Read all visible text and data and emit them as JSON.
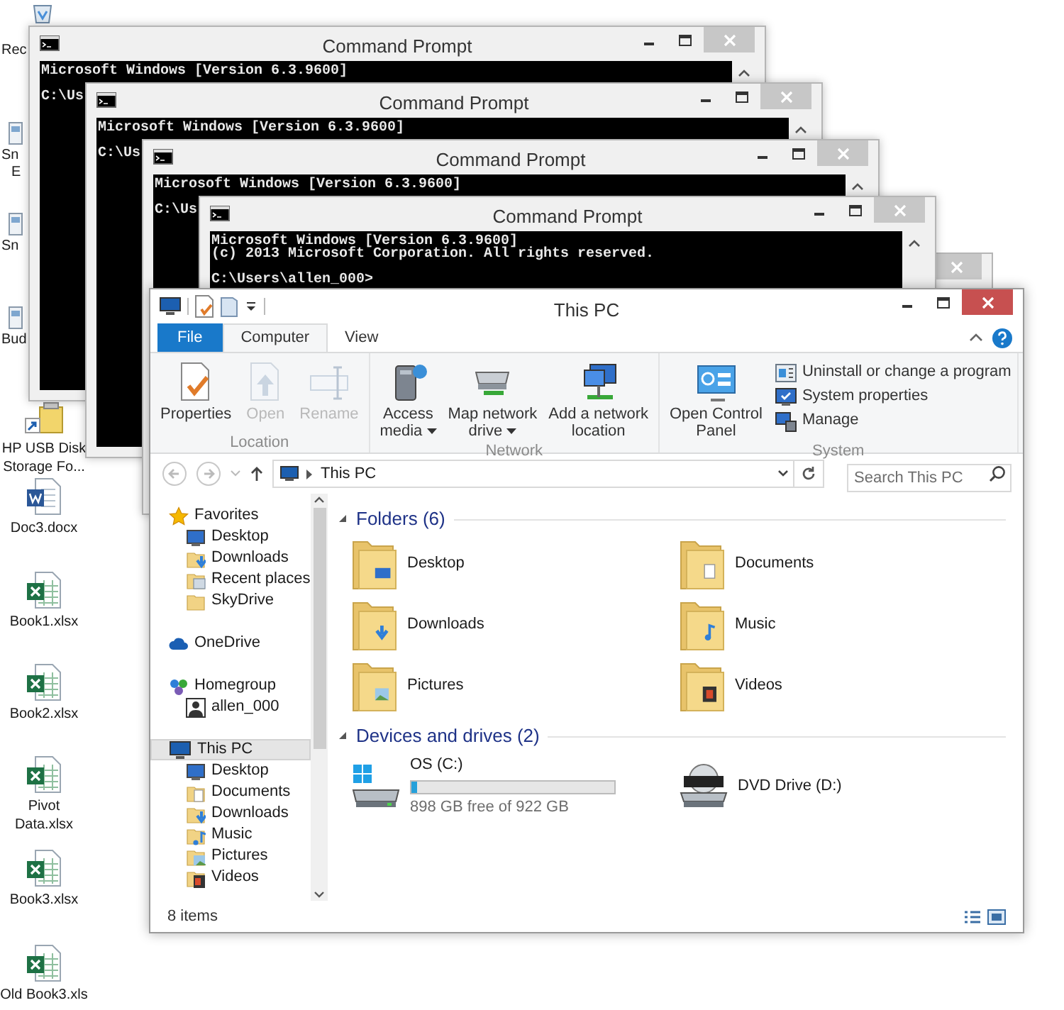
{
  "desktop_icons": [
    {
      "kind": "recycle",
      "lines": [
        "Rec"
      ]
    },
    {
      "kind": "app",
      "lines": [
        "Sn",
        "E"
      ]
    },
    {
      "kind": "app",
      "lines": [
        "Sn"
      ]
    },
    {
      "kind": "app",
      "lines": [
        "Bud"
      ]
    },
    {
      "kind": "usb",
      "lines": [
        "HP USB Disk",
        "Storage Fo..."
      ]
    },
    {
      "kind": "word",
      "lines": [
        "Doc3.docx"
      ]
    },
    {
      "kind": "excel",
      "lines": [
        "Book1.xlsx"
      ]
    },
    {
      "kind": "excel",
      "lines": [
        "Book2.xlsx"
      ]
    },
    {
      "kind": "excel",
      "lines": [
        "Pivot",
        "Data.xlsx"
      ]
    },
    {
      "kind": "excel",
      "lines": [
        "Book3.xlsx"
      ]
    },
    {
      "kind": "excel",
      "lines": [
        "Old Book3.xls"
      ]
    }
  ],
  "console_windows": [
    {
      "title": "Command Prompt",
      "output": [
        "Microsoft Windows [Version 6.3.9600]"
      ],
      "prompt": "C:\\Us"
    },
    {
      "title": "Command Prompt",
      "output": [
        "Microsoft Windows [Version 6.3.9600]"
      ],
      "prompt": "C:\\Us"
    },
    {
      "title": "Command Prompt",
      "output": [
        "Microsoft Windows [Version 6.3.9600]"
      ],
      "prompt": "C:\\Us"
    },
    {
      "title": "Command Prompt",
      "output": [
        "Microsoft Windows [Version 6.3.9600]",
        "(c) 2013 Microsoft Corporation. All rights reserved."
      ],
      "prompt": "C:\\Users\\allen_000>"
    }
  ],
  "background_window": {
    "visible": true
  },
  "explorer": {
    "title": "This PC",
    "tabs": [
      {
        "label": "File",
        "kind": "file",
        "selected": false
      },
      {
        "label": "Computer",
        "kind": "tab",
        "selected": true
      },
      {
        "label": "View",
        "kind": "tab",
        "selected": false
      }
    ],
    "ribbon_groups": [
      {
        "label": "Location",
        "buttons": [
          {
            "lines": [
              "Properties"
            ],
            "kind": "properties",
            "disabled": false,
            "dropdown": false
          },
          {
            "lines": [
              "Open"
            ],
            "kind": "open",
            "disabled": true,
            "dropdown": false
          },
          {
            "lines": [
              "Rename"
            ],
            "kind": "rename",
            "disabled": true,
            "dropdown": false
          }
        ]
      },
      {
        "label": "Network",
        "buttons": [
          {
            "lines": [
              "Access",
              "media"
            ],
            "kind": "media",
            "disabled": false,
            "dropdown": true
          },
          {
            "lines": [
              "Map network",
              "drive"
            ],
            "kind": "netdrive",
            "disabled": false,
            "dropdown": true
          },
          {
            "lines": [
              "Add a network",
              "location"
            ],
            "kind": "netloc",
            "disabled": false,
            "dropdown": false
          }
        ]
      },
      {
        "label": "System",
        "buttons": [
          {
            "lines": [
              "Open Control",
              "Panel"
            ],
            "kind": "control",
            "disabled": false,
            "dropdown": false
          }
        ],
        "small_buttons": [
          {
            "label": "Uninstall or change a program",
            "kind": "uninstall"
          },
          {
            "label": "System properties",
            "kind": "sysprops"
          },
          {
            "label": "Manage",
            "kind": "manage"
          }
        ]
      }
    ],
    "address": {
      "path": "This PC"
    },
    "search": {
      "placeholder": "Search This PC"
    },
    "nav": [
      {
        "label": "Favorites",
        "kind": "star",
        "selected": false,
        "children": [
          {
            "label": "Desktop",
            "kind": "desktop",
            "selected": false
          },
          {
            "label": "Downloads",
            "kind": "downloads",
            "selected": false
          },
          {
            "label": "Recent places",
            "kind": "recent",
            "selected": false
          },
          {
            "label": "SkyDrive",
            "kind": "folder",
            "selected": false
          }
        ]
      },
      {
        "label": "OneDrive",
        "kind": "cloud",
        "selected": false
      },
      {
        "label": "Homegroup",
        "kind": "homegroup",
        "selected": false,
        "children": [
          {
            "label": "allen_000",
            "kind": "user",
            "selected": false
          }
        ]
      },
      {
        "label": "This PC",
        "kind": "pc",
        "selected": true,
        "children": [
          {
            "label": "Desktop",
            "kind": "desktop",
            "selected": false
          },
          {
            "label": "Documents",
            "kind": "documents",
            "selected": false
          },
          {
            "label": "Downloads",
            "kind": "downloads",
            "selected": false
          },
          {
            "label": "Music",
            "kind": "music",
            "selected": false
          },
          {
            "label": "Pictures",
            "kind": "pictures",
            "selected": false
          },
          {
            "label": "Videos",
            "kind": "videos",
            "selected": false
          }
        ]
      }
    ],
    "folders_header": "Folders (6)",
    "folders": [
      {
        "label": "Desktop",
        "kind": "desktop"
      },
      {
        "label": "Documents",
        "kind": "documents"
      },
      {
        "label": "Downloads",
        "kind": "downloads"
      },
      {
        "label": "Music",
        "kind": "music"
      },
      {
        "label": "Pictures",
        "kind": "pictures"
      },
      {
        "label": "Videos",
        "kind": "videos"
      }
    ],
    "drives_header": "Devices and drives (2)",
    "drives": [
      {
        "kind": "disk",
        "label": "OS (C:)",
        "level": 0.03,
        "free": "898 GB free of 922 GB"
      },
      {
        "kind": "dvd",
        "label": "DVD Drive (D:)"
      }
    ],
    "status": "8 items"
  }
}
